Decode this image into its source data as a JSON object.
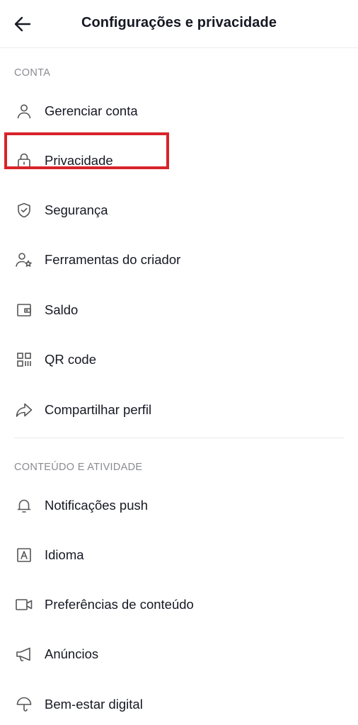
{
  "header": {
    "title": "Configurações e privacidade",
    "back_icon": "arrow-left-icon"
  },
  "sections": [
    {
      "title": "CONTA",
      "items": [
        {
          "label": "Gerenciar conta",
          "icon": "user-icon"
        },
        {
          "label": "Privacidade",
          "icon": "lock-icon"
        },
        {
          "label": "Segurança",
          "icon": "shield-check-icon"
        },
        {
          "label": "Ferramentas do criador",
          "icon": "user-star-icon"
        },
        {
          "label": "Saldo",
          "icon": "wallet-icon"
        },
        {
          "label": "QR code",
          "icon": "qr-code-icon"
        },
        {
          "label": "Compartilhar perfil",
          "icon": "share-arrow-icon"
        }
      ]
    },
    {
      "title": "CONTEÚDO E ATIVIDADE",
      "items": [
        {
          "label": "Notificações push",
          "icon": "bell-icon"
        },
        {
          "label": "Idioma",
          "icon": "language-icon"
        },
        {
          "label": "Preferências de conteúdo",
          "icon": "video-camera-icon"
        },
        {
          "label": "Anúncios",
          "icon": "megaphone-icon"
        },
        {
          "label": "Bem-estar digital",
          "icon": "umbrella-icon"
        }
      ]
    }
  ],
  "colors": {
    "highlight": "#d8232a",
    "section_title": "#8a8b91",
    "text": "#161823"
  }
}
